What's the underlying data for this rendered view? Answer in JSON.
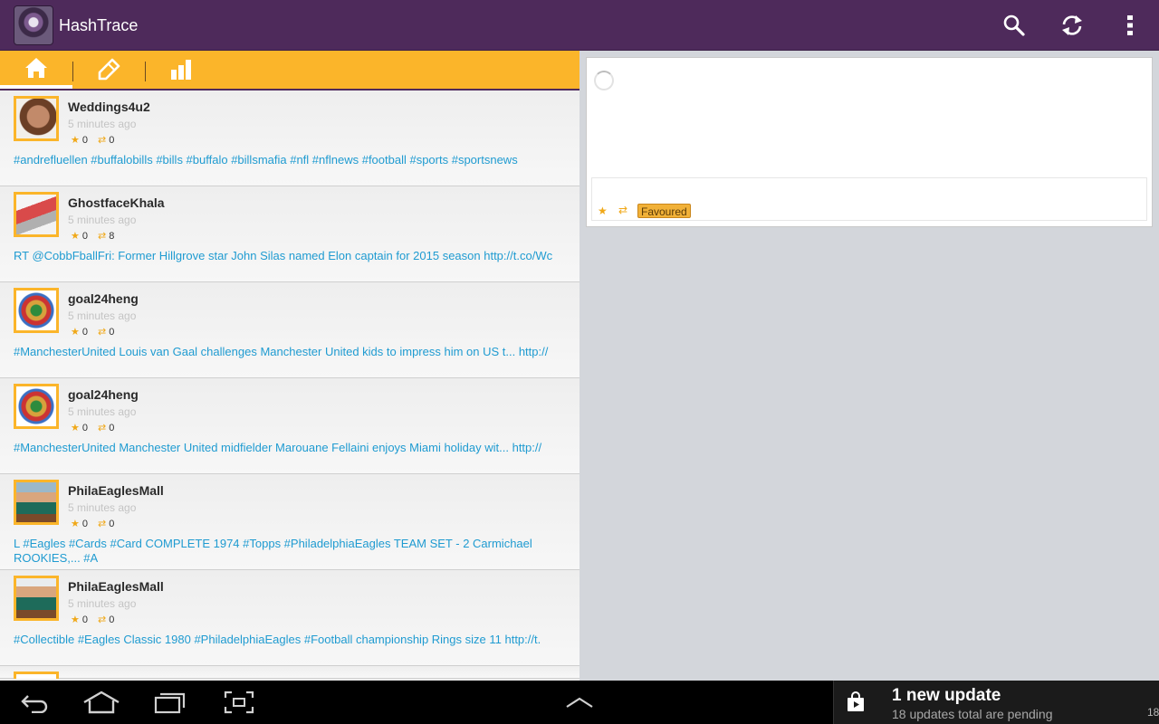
{
  "app": {
    "title": "HashTrace"
  },
  "actionbar": {
    "icons": [
      "search-icon",
      "refresh-icon",
      "overflow-menu-icon"
    ]
  },
  "tabs": [
    {
      "name": "home",
      "icon": "home-icon",
      "active": true
    },
    {
      "name": "compose",
      "icon": "pencil-icon",
      "active": false
    },
    {
      "name": "stats",
      "icon": "bar-chart-icon",
      "active": false
    }
  ],
  "tweets": [
    {
      "user": "Weddings4u2",
      "time": "5 minutes ago",
      "favs": "0",
      "rts": "0",
      "text": "#andrefluellen #buffalobills #bills #buffalo #billsmafia #nfl #nflnews #football #sports #sportsnews"
    },
    {
      "user": "GhostfaceKhala",
      "time": "5 minutes ago",
      "favs": "0",
      "rts": "8",
      "text": "RT @CobbFballFri: Former Hillgrove star John Silas named Elon captain for 2015 season http://t.co/Wc"
    },
    {
      "user": "goal24heng",
      "time": "5 minutes ago",
      "favs": "0",
      "rts": "0",
      "text": "#ManchesterUnited Louis van Gaal challenges Manchester United kids to impress him on US t... http://"
    },
    {
      "user": "goal24heng",
      "time": "5 minutes ago",
      "favs": "0",
      "rts": "0",
      "text": "#ManchesterUnited Manchester United midfielder Marouane Fellaini enjoys Miami holiday wit... http://"
    },
    {
      "user": "PhilaEaglesMall",
      "time": "5 minutes ago",
      "favs": "0",
      "rts": "0",
      "text": "L #Eagles #Cards #Card COMPLETE 1974 #Topps #PhiladelphiaEagles TEAM SET - 2 Carmichael ROOKIES,... #A"
    },
    {
      "user": "PhilaEaglesMall",
      "time": "5 minutes ago",
      "favs": "0",
      "rts": "0",
      "text": "#Collectible #Eagles Classic 1980 #PhiladelphiaEagles #Football championship Rings size 11 http://t."
    }
  ],
  "detail": {
    "badge": "Favoured"
  },
  "notification": {
    "title": "1 new update",
    "subtitle": "18 updates total are pending",
    "clock": "18"
  },
  "colors": {
    "actionbar": "#4e2a5b",
    "tabbar": "#fbb52a",
    "link": "#1f9bd1",
    "accent": "#f0a818"
  }
}
